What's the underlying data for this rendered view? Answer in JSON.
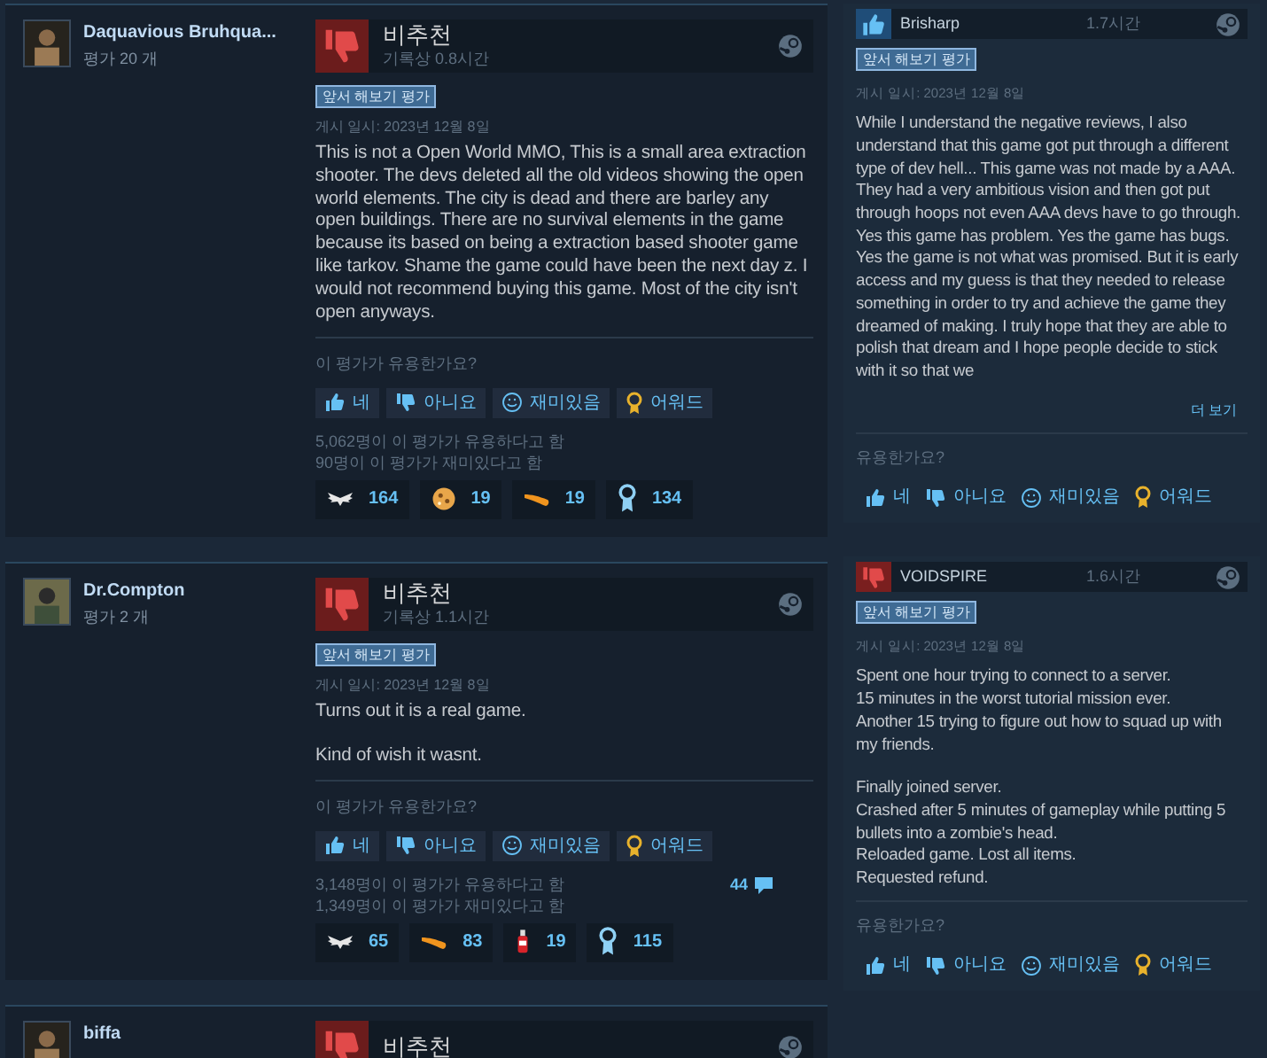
{
  "main_reviews": [
    {
      "author": "Daquavious Bruhqua...",
      "review_count": "평가 20 개",
      "verdict": {
        "kind": "negative",
        "label": "비추천"
      },
      "hours": "기록상 0.8시간",
      "badge": "앞서 해보기 평가",
      "date": "게시 일시: 2023년 12월 8일",
      "body": [
        "This is not a Open World MMO, This is a small area extraction shooter. The devs deleted all the old videos showing the open world elements. The city is dead and there are barley any open buildings. There are no survival elements in the game because its based on being a extraction based shooter game like tarkov. Shame the game could have been the next day z. I would not recommend buying this game. Most of the city isn't open anyways."
      ],
      "prompt": "이 평가가 유용한가요?",
      "buttons": [
        {
          "kind": "yes",
          "label": "네"
        },
        {
          "kind": "no",
          "label": "아니요"
        },
        {
          "kind": "funny",
          "label": "재미있음"
        },
        {
          "kind": "award",
          "label": "어워드"
        }
      ],
      "helpful": "5,062명이 이 평가가 유용하다고 함",
      "funny": "90명이 이 평가가 재미있다고 함",
      "awards": [
        {
          "kind": "wings",
          "count": "164"
        },
        {
          "kind": "cookie",
          "count": "19"
        },
        {
          "kind": "horn",
          "count": "19"
        },
        {
          "kind": "medal",
          "count": "134"
        }
      ]
    },
    {
      "author": "Dr.Compton",
      "review_count": "평가 2 개",
      "verdict": {
        "kind": "negative",
        "label": "비추천"
      },
      "hours": "기록상 1.1시간",
      "badge": "앞서 해보기 평가",
      "date": "게시 일시: 2023년 12월 8일",
      "body": [
        "Turns out it is a real game.",
        "Kind of wish it wasnt."
      ],
      "prompt": "이 평가가 유용한가요?",
      "buttons": [
        {
          "kind": "yes",
          "label": "네"
        },
        {
          "kind": "no",
          "label": "아니요"
        },
        {
          "kind": "funny",
          "label": "재미있음"
        },
        {
          "kind": "award",
          "label": "어워드"
        }
      ],
      "helpful": "3,148명이 이 평가가 유용하다고 함",
      "funny": "1,349명이 이 평가가 재미있다고 함",
      "comments": "44",
      "awards": [
        {
          "kind": "wings",
          "count": "65"
        },
        {
          "kind": "horn",
          "count": "83"
        },
        {
          "kind": "bottle",
          "count": "19"
        },
        {
          "kind": "medal",
          "count": "115"
        }
      ]
    },
    {
      "author": "biffa",
      "verdict": {
        "kind": "negative",
        "label": "비추천"
      }
    }
  ],
  "side_reviews": [
    {
      "author": "Brisharp",
      "verdict": {
        "kind": "positive"
      },
      "hours": "1.7시간",
      "badge": "앞서 해보기 평가",
      "date": "게시 일시: 2023년 12월 8일",
      "body": [
        "While I understand the negative reviews, I also understand that this game got put through a different type of dev hell... This game was not made by a AAA. They had a very ambitious vision and then got put through hoops not even AAA devs have to go through. Yes this game has problem. Yes the game has bugs. Yes the game is not what was promised. But it is early access and my guess is that they needed to release something in order to try and achieve the game they dreamed of making. I truly hope that they are able to polish that dream and I hope people decide to stick with it so that we"
      ],
      "more": "더 보기",
      "prompt": "유용한가요?",
      "buttons": [
        {
          "kind": "yes",
          "label": "네"
        },
        {
          "kind": "no",
          "label": "아니요"
        },
        {
          "kind": "funny",
          "label": "재미있음"
        },
        {
          "kind": "award",
          "label": "어워드"
        }
      ]
    },
    {
      "author": "VOIDSPIRE",
      "verdict": {
        "kind": "negative"
      },
      "hours": "1.6시간",
      "badge": "앞서 해보기 평가",
      "date": "게시 일시: 2023년 12월 8일",
      "body": [
        "Spent one hour trying to connect to a server.\n15 minutes in the worst tutorial mission ever.\nAnother 15 trying to figure out how to squad up with my friends.",
        "Finally joined server.\nCrashed after 5 minutes of gameplay while putting 5 bullets into a zombie's head.\nReloaded game. Lost all items.\nRequested refund."
      ],
      "prompt": "유용한가요?",
      "buttons": [
        {
          "kind": "yes",
          "label": "네"
        },
        {
          "kind": "no",
          "label": "아니요"
        },
        {
          "kind": "funny",
          "label": "재미있음"
        },
        {
          "kind": "award",
          "label": "어워드"
        }
      ]
    }
  ]
}
